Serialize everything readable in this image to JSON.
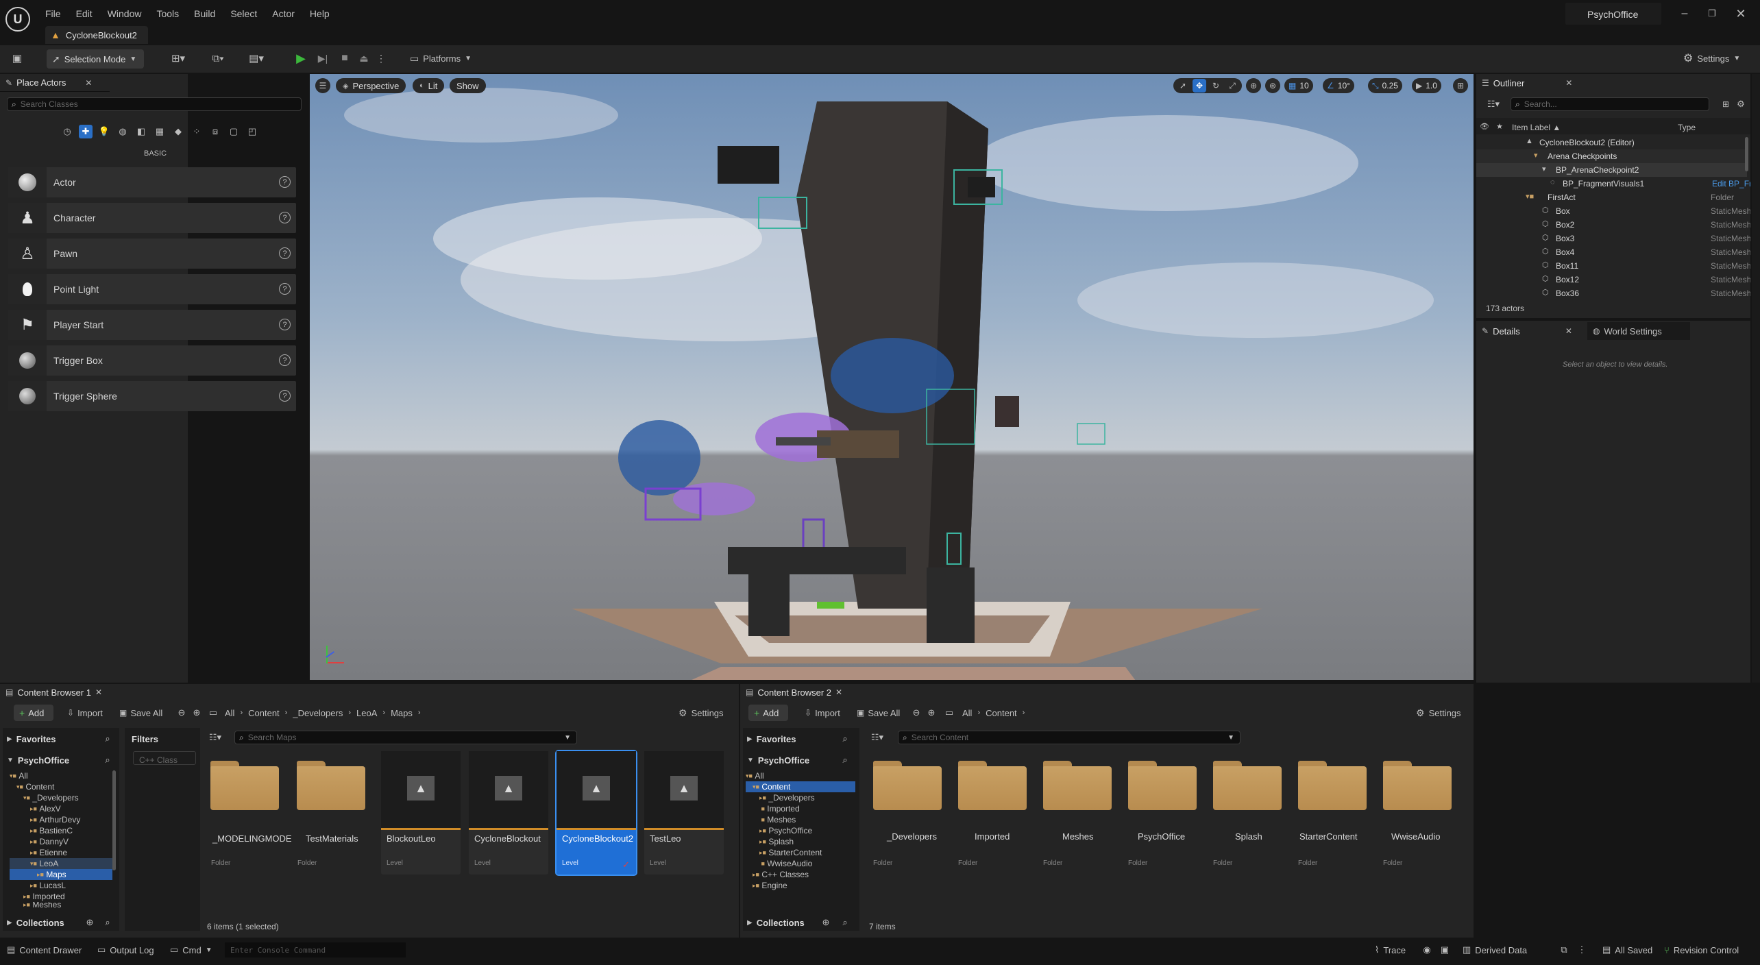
{
  "menu": {
    "items": [
      "File",
      "Edit",
      "Window",
      "Tools",
      "Build",
      "Select",
      "Actor",
      "Help"
    ],
    "project": "PsychOffice"
  },
  "level_tab": "CycloneBlockout2",
  "toolbar": {
    "selection_mode": "Selection Mode",
    "platforms": "Platforms",
    "settings": "Settings"
  },
  "place_actors": {
    "tab": "Place Actors",
    "search_placeholder": "Search Classes",
    "category": "BASIC",
    "items": [
      "Actor",
      "Character",
      "Pawn",
      "Point Light",
      "Player Start",
      "Trigger Box",
      "Trigger Sphere"
    ]
  },
  "viewport": {
    "perspective": "Perspective",
    "lit": "Lit",
    "show": "Show",
    "grid_snap": "10",
    "rot_snap": "10°",
    "scale_snap": "0.25",
    "cam_speed": "1.0"
  },
  "outliner": {
    "tab": "Outliner",
    "search_placeholder": "Search...",
    "col_label": "Item Label ▲",
    "col_type": "Type",
    "rows": [
      {
        "label": "CycloneBlockout2 (Editor)",
        "type": ""
      },
      {
        "label": "Arena Checkpoints",
        "type": ""
      },
      {
        "label": "BP_ArenaCheckpoint2",
        "type": ""
      },
      {
        "label": "BP_FragmentVisuals1",
        "type": "Edit BP_Fragme"
      },
      {
        "label": "FirstAct",
        "type": "Folder"
      },
      {
        "label": "Box",
        "type": "StaticMeshActo"
      },
      {
        "label": "Box2",
        "type": "StaticMeshActo"
      },
      {
        "label": "Box3",
        "type": "StaticMeshActo"
      },
      {
        "label": "Box4",
        "type": "StaticMeshActo"
      },
      {
        "label": "Box11",
        "type": "StaticMeshActo"
      },
      {
        "label": "Box12",
        "type": "StaticMeshActo"
      },
      {
        "label": "Box36",
        "type": "StaticMeshActo"
      }
    ],
    "count": "173 actors"
  },
  "details": {
    "tab": "Details",
    "world_tab": "World Settings",
    "empty": "Select an object to view details."
  },
  "cb1": {
    "tab": "Content Browser 1",
    "add": "Add",
    "import": "Import",
    "save_all": "Save All",
    "settings": "Settings",
    "crumbs": [
      "All",
      "Content",
      "_Developers",
      "LeoA",
      "Maps"
    ],
    "favorites": "Favorites",
    "root": "PsychOffice",
    "filters": "Filters",
    "filter_chip": "C++ Class",
    "search_placeholder": "Search Maps",
    "tree": [
      "All",
      "Content",
      "_Developers",
      "AlexV",
      "ArthurDevy",
      "BastienC",
      "DannyV",
      "Etienne",
      "LeoA",
      "Maps",
      "LucasL",
      "Imported",
      "Meshes"
    ],
    "collections": "Collections",
    "assets": [
      {
        "name": "_MODELINGMODE",
        "type": "Folder"
      },
      {
        "name": "TestMaterials",
        "type": "Folder"
      },
      {
        "name": "BlockoutLeo",
        "type": "Level"
      },
      {
        "name": "CycloneBlockout",
        "type": "Level"
      },
      {
        "name": "CycloneBlockout2",
        "type": "Level"
      },
      {
        "name": "TestLeo",
        "type": "Level"
      }
    ],
    "status": "6 items (1 selected)"
  },
  "cb2": {
    "tab": "Content Browser 2",
    "add": "Add",
    "import": "Import",
    "save_all": "Save All",
    "settings": "Settings",
    "crumbs": [
      "All",
      "Content"
    ],
    "favorites": "Favorites",
    "root": "PsychOffice",
    "search_placeholder": "Search Content",
    "tree": [
      "All",
      "Content",
      "_Developers",
      "Imported",
      "Meshes",
      "PsychOffice",
      "Splash",
      "StarterContent",
      "WwiseAudio",
      "C++ Classes",
      "Engine"
    ],
    "collections": "Collections",
    "assets": [
      {
        "name": "_Developers",
        "type": "Folder"
      },
      {
        "name": "Imported",
        "type": "Folder"
      },
      {
        "name": "Meshes",
        "type": "Folder"
      },
      {
        "name": "PsychOffice",
        "type": "Folder"
      },
      {
        "name": "Splash",
        "type": "Folder"
      },
      {
        "name": "StarterContent",
        "type": "Folder"
      },
      {
        "name": "WwiseAudio",
        "type": "Folder"
      }
    ],
    "status": "7 items"
  },
  "statusbar": {
    "content_drawer": "Content Drawer",
    "output_log": "Output Log",
    "cmd": "Cmd",
    "console_placeholder": "Enter Console Command",
    "trace": "Trace",
    "derived_data": "Derived Data",
    "all_saved": "All Saved",
    "revision_control": "Revision Control"
  }
}
